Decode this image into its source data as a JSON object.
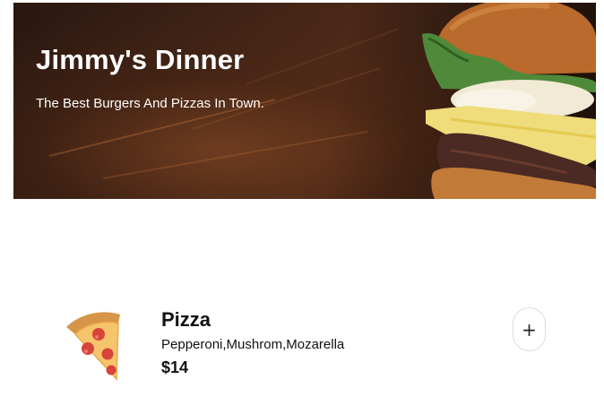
{
  "hero": {
    "title": "Jimmy's Dinner",
    "subtitle": "The Best Burgers And Pizzas In Town."
  },
  "menu": {
    "items": [
      {
        "name": "Pizza",
        "description": "Pepperoni,Mushrom,Mozarella",
        "price": "$14",
        "icon": "pizza-slice-icon",
        "add_label": "+"
      }
    ]
  },
  "colors": {
    "hero_text": "#ffffff",
    "body_text": "#111111",
    "button_border": "#dddddd",
    "background": "#ffffff"
  }
}
